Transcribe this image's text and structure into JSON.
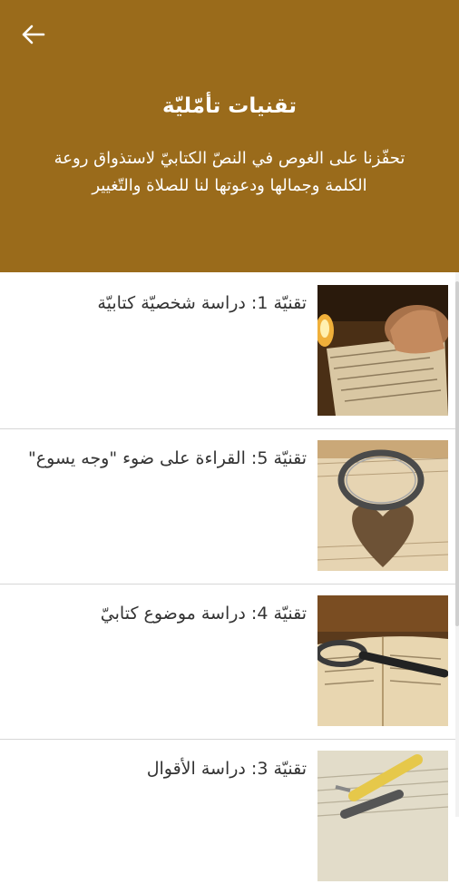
{
  "header": {
    "title": "تقنيات تأمّليّة",
    "description": "تحفّزنا على الغوص في النصّ الكتابيّ لاستذواق روعة الكلمة وجمالها ودعوتها لنا للصلاة والتّغيير"
  },
  "items": [
    {
      "title": "تقنيّة 1: دراسة شخصيّة كتابيّة",
      "image": "book-candle-prayer-hands"
    },
    {
      "title": "تقنيّة 5: القراءة على ضوء \"وجه يسوع\"",
      "image": "ring-heart-shadow-book"
    },
    {
      "title": "تقنيّة 4: دراسة موضوع كتابيّ",
      "image": "magnifier-on-book"
    },
    {
      "title": "تقنيّة 3: دراسة الأقوال",
      "image": "pen-and-highlighter-on-book"
    }
  ],
  "colors": {
    "header_bg": "#9a6b1b",
    "text": "#333333",
    "divider": "#d7d7d7"
  }
}
